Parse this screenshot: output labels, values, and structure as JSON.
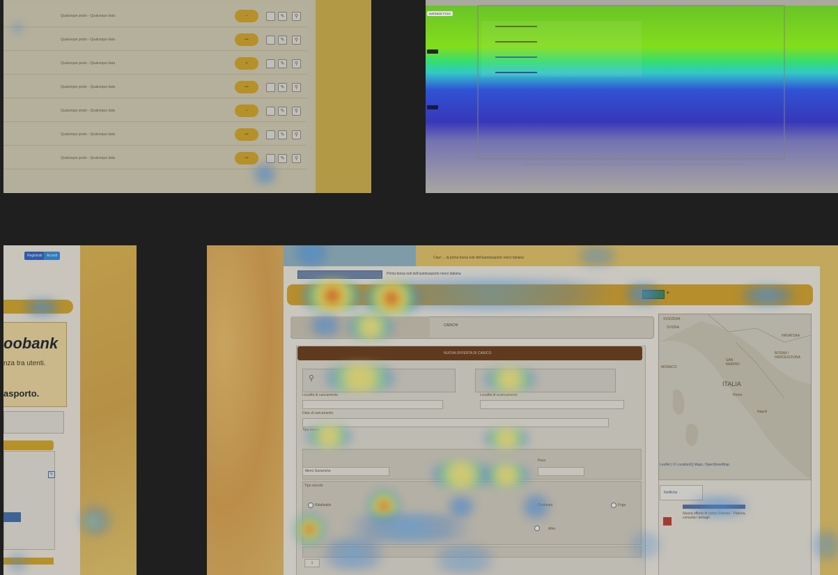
{
  "panel_a": {
    "rows": [
      {
        "text": "Qualunque posto - Qualunque data",
        "pill": "•"
      },
      {
        "text": "Qualunque posto - Qualunque data",
        "pill": "•••"
      },
      {
        "text": "Qualunque posto - Qualunque data",
        "pill": "••"
      },
      {
        "text": "Qualunque posto - Qualunque data",
        "pill": "•••"
      },
      {
        "text": "Qualunque posto - Qualunque data",
        "pill": "•"
      },
      {
        "text": "Qualunque posto - Qualunque data",
        "pill": "•••"
      },
      {
        "text": "Qualunque posto - Qualunque data",
        "pill": "•••"
      }
    ]
  },
  "panel_b": {
    "labels": [
      "AVERAGE FOLD",
      "",
      ""
    ]
  },
  "panel_c": {
    "buttons": [
      "Registrati",
      "Accedi"
    ],
    "brand": "oobank",
    "tagline": "nza tra utenti.",
    "transport": "asporto."
  },
  "panel_d": {
    "notice": "Ciao! ... la prima borsa noli dell'autotrasporto merci italiana",
    "banner": "Prima borsa noli dell'autotrasporto merci italiana",
    "form_title": "NUOVA OFFERTA DI CARICO",
    "tab_label": "CARICHI",
    "map_labels": [
      "SVIZZERA",
      "SVIZRA",
      "HRVATSKA",
      "BOSNA I HERCEGOVINA",
      "MONACO",
      "SAN MARINO",
      "ITALIA",
      "Roma",
      "Napoli"
    ],
    "map_credit": "Leaflet | © LocationIQ Maps, OpenStreetMap",
    "news_tab": "Notifiche",
    "news_text": "Nuova offerta di carico Firenze - Padova, consulta i dettagli",
    "field_labels": [
      "Località di caricamento",
      "Località di scaricamento",
      "Data di caricamento",
      "Tipo merce",
      "Peso",
      "Tipo veicolo"
    ],
    "select_value": "Merci Generiche",
    "options": [
      "Ribaltabile",
      "Centinato",
      "Frigo",
      "Altro"
    ]
  }
}
